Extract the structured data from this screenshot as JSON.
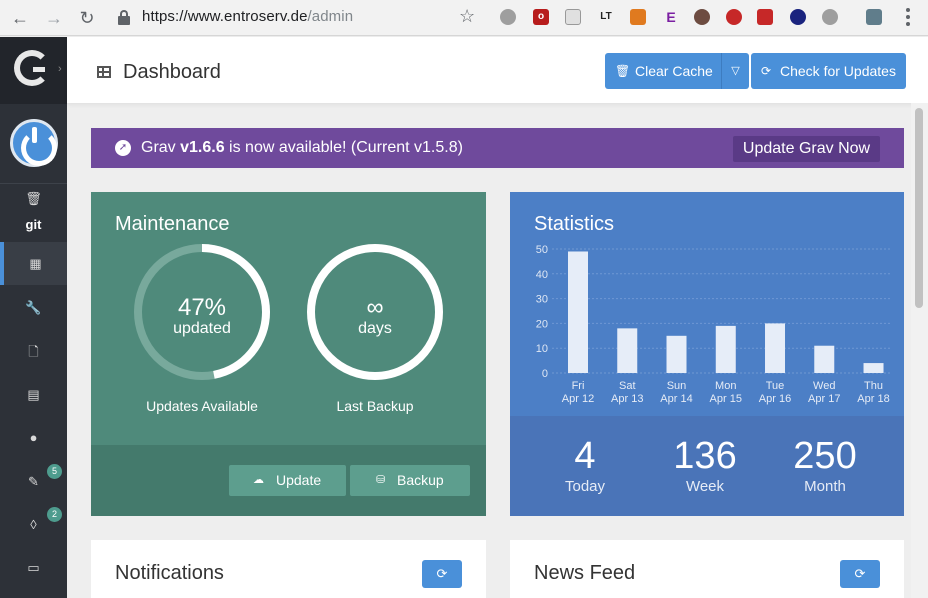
{
  "browser": {
    "url_host": "https://www.entroserv.de",
    "url_path": "/admin"
  },
  "sidebar": {
    "git_label": "git",
    "plugins_badge": "5",
    "themes_badge": "2"
  },
  "header": {
    "title": "Dashboard",
    "clear_cache": "Clear Cache",
    "check_updates": "Check for Updates"
  },
  "notice": {
    "prefix": "Grav ",
    "version": "v1.6.6",
    "suffix": " is now available! (Current v1.5.8)",
    "button": "Update Grav Now"
  },
  "maintenance": {
    "title": "Maintenance",
    "updates_pct": "47%",
    "updates_pct_value": 0.47,
    "updates_sub": "updated",
    "updates_label": "Updates Available",
    "backup_value": "∞",
    "backup_sub": "days",
    "backup_label": "Last Backup",
    "update_btn": "Update",
    "backup_btn": "Backup"
  },
  "statistics": {
    "title": "Statistics",
    "today": "4",
    "today_label": "Today",
    "week": "136",
    "week_label": "Week",
    "month": "250",
    "month_label": "Month"
  },
  "chart_data": {
    "type": "bar",
    "categories": [
      "Fri",
      "Sat",
      "Sun",
      "Mon",
      "Tue",
      "Wed",
      "Thu"
    ],
    "dates": [
      "Apr 12",
      "Apr 13",
      "Apr 14",
      "Apr 15",
      "Apr 16",
      "Apr 17",
      "Apr 18"
    ],
    "values": [
      49,
      18,
      15,
      19,
      20,
      11,
      4
    ],
    "yticks": [
      0,
      10,
      20,
      30,
      40,
      50
    ],
    "ylim": [
      0,
      50
    ],
    "grid": true
  },
  "bottom": {
    "notifications": "Notifications",
    "news_feed": "News Feed"
  },
  "colors": {
    "sidebar": "#2d3138",
    "accent": "#4a90d9",
    "maintenance": "#4f8a7b",
    "statistics": "#4c7fc6",
    "notice": "#6f4a9c"
  }
}
